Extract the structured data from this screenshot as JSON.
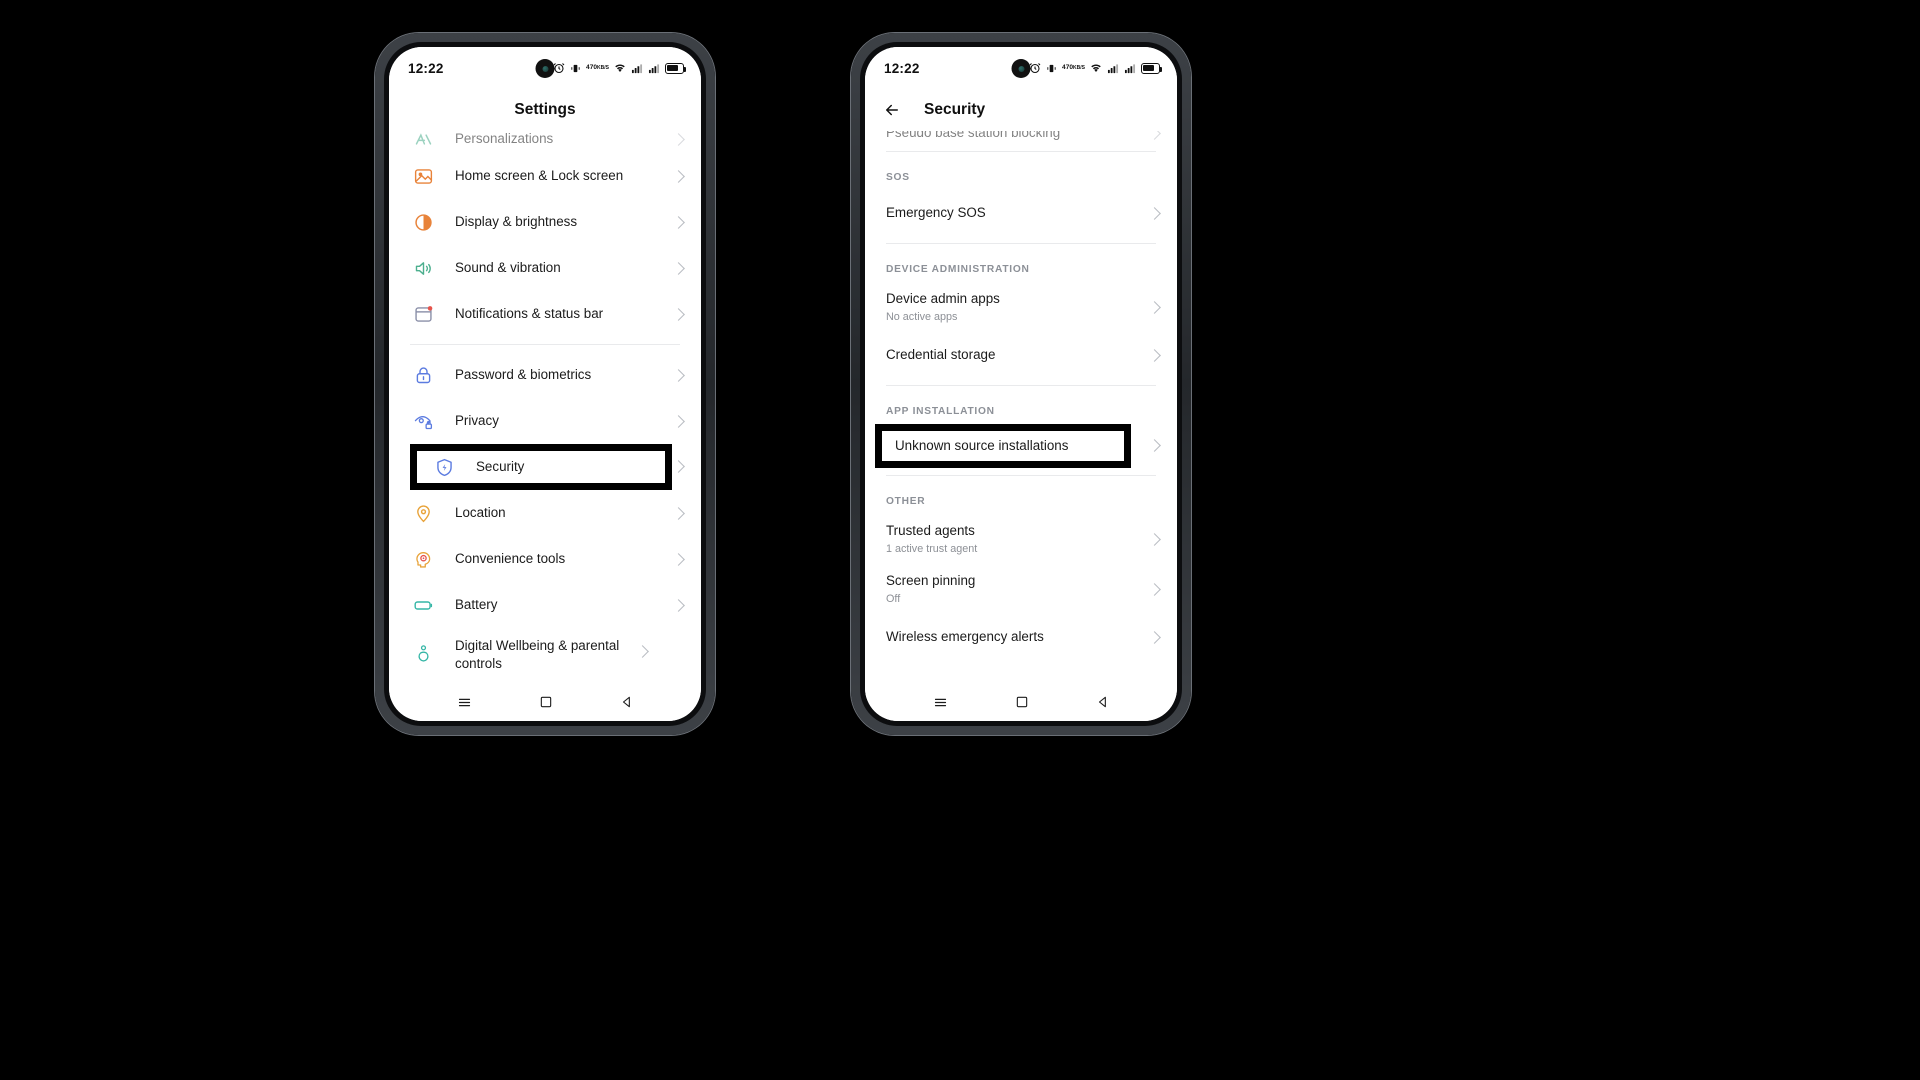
{
  "status_bar": {
    "time": "12:22",
    "icons": [
      "alarm-icon",
      "vibrate-icon",
      "data-speed-470",
      "wifi-icon",
      "signal-icon",
      "signal2-icon",
      "battery-icon"
    ],
    "data_speed": "470"
  },
  "colors": {
    "highlight_border": "#000000",
    "chevron": "#b9bcc2",
    "section_header": "#8c9097",
    "subtitle": "#8d9096",
    "text": "#1b1b1b",
    "icon_green": "#4caf8e",
    "icon_orange": "#e8833a",
    "icon_blue": "#5b7be0",
    "icon_red": "#e5534b",
    "icon_teal": "#35b6a6"
  },
  "screen_left": {
    "title": "Settings",
    "nav": [
      "menu-icon",
      "home-icon",
      "back-icon"
    ],
    "items": [
      {
        "label": "Personalizations",
        "icon": "personalizations-icon",
        "clipped": true
      },
      {
        "label": "Home screen & Lock screen",
        "icon": "home-lock-screen-icon"
      },
      {
        "label": "Display & brightness",
        "icon": "display-brightness-icon"
      },
      {
        "label": "Sound & vibration",
        "icon": "sound-vibration-icon"
      },
      {
        "label": "Notifications & status bar",
        "icon": "notifications-icon"
      },
      {
        "label": "Password & biometrics",
        "icon": "password-biometrics-icon",
        "divider_before": true
      },
      {
        "label": "Privacy",
        "icon": "privacy-icon"
      },
      {
        "label": "Security",
        "icon": "security-icon",
        "highlighted": true
      },
      {
        "label": "Location",
        "icon": "location-icon"
      },
      {
        "label": "Convenience tools",
        "icon": "convenience-tools-icon"
      },
      {
        "label": "Battery",
        "icon": "battery-settings-icon"
      },
      {
        "label": "Digital Wellbeing & parental controls",
        "icon": "digital-wellbeing-icon"
      }
    ]
  },
  "screen_right": {
    "title": "Security",
    "back": "back-arrow-icon",
    "nav": [
      "menu-icon",
      "home-icon",
      "back-icon"
    ],
    "items": [
      {
        "label": "Pseudo base station blocking",
        "clipped": true
      },
      {
        "section": "SOS",
        "divider_before": true
      },
      {
        "label": "Emergency SOS"
      },
      {
        "section": "DEVICE ADMINISTRATION",
        "divider_before": true
      },
      {
        "label": "Device admin apps",
        "sub": "No active apps"
      },
      {
        "label": "Credential storage"
      },
      {
        "section": "APP INSTALLATION",
        "divider_before": true
      },
      {
        "label": "Unknown source installations",
        "highlighted": true
      },
      {
        "section": "OTHER",
        "divider_before": true
      },
      {
        "label": "Trusted agents",
        "sub": "1 active trust agent"
      },
      {
        "label": "Screen pinning",
        "sub": "Off"
      },
      {
        "label": "Wireless emergency alerts"
      }
    ]
  }
}
